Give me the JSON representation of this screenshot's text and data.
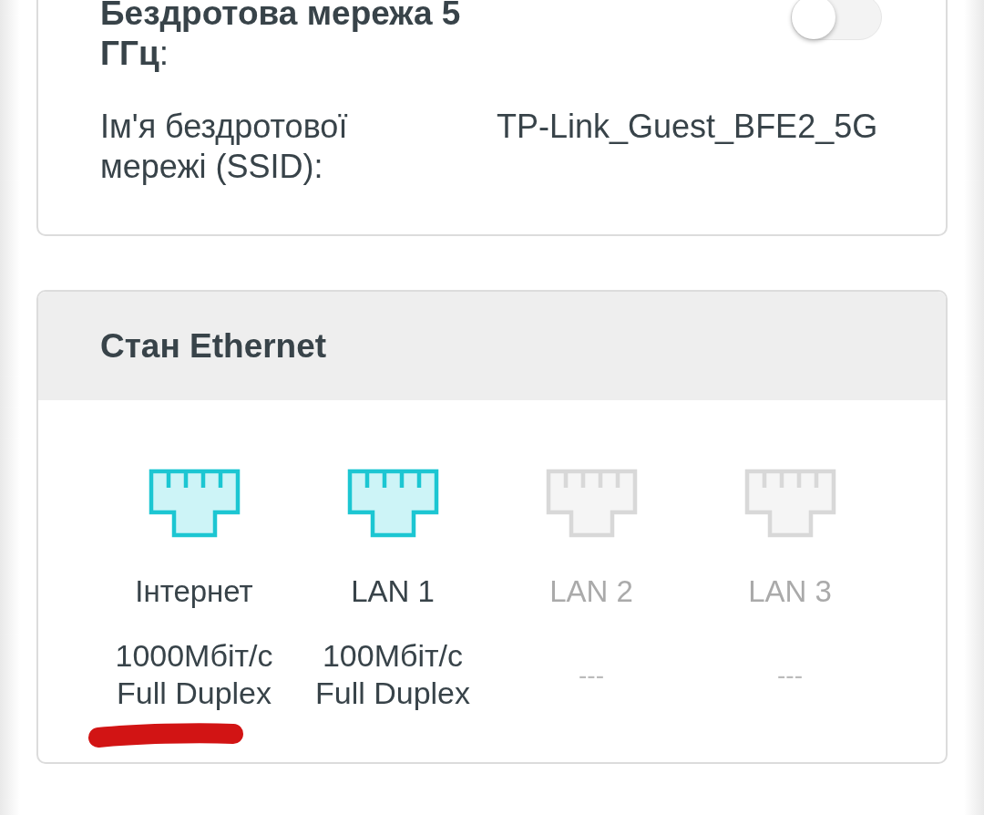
{
  "wireless_5ghz": {
    "label": "**Бездротова мережа 5 ГГц**:",
    "enabled": false,
    "ssid_label": "Ім'я бездротової мережі (SSID):",
    "ssid": "TP-Link_Guest_BFE2_5G"
  },
  "ethernet": {
    "title": "Стан Ethernet",
    "ports": [
      {
        "name": "Інтернет",
        "connected": true,
        "status": "1000Мбіт/с Full Duplex",
        "underlined": true
      },
      {
        "name": "LAN 1",
        "connected": true,
        "status": "100Мбіт/с Full Duplex",
        "underlined": false
      },
      {
        "name": "LAN 2",
        "connected": false,
        "status": "---",
        "underlined": false
      },
      {
        "name": "LAN 3",
        "connected": false,
        "status": "---",
        "underlined": false
      }
    ]
  }
}
